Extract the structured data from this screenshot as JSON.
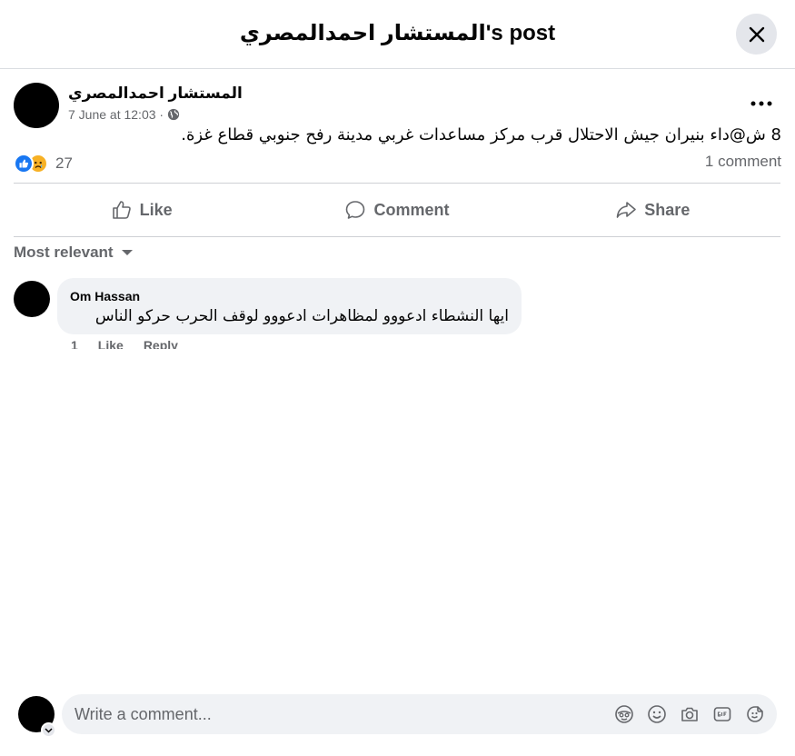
{
  "header": {
    "title": "المستشار احمدالمصري's post"
  },
  "post": {
    "author": "المستشار احمدالمصري",
    "timestamp": "7 June at 12:03 ·",
    "text": "8 ش@داء بنيران جيش الاحتلال قرب مركز مساعدات غربي مدينة رفح جنوبي قطاع غزة.",
    "reaction_count": "27",
    "comment_count": "1 comment",
    "reactions": [
      "like",
      "sad"
    ]
  },
  "actions": {
    "like": "Like",
    "comment": "Comment",
    "share": "Share"
  },
  "sort": {
    "label": "Most relevant"
  },
  "comments": [
    {
      "author": "Om Hassan",
      "text": "ايها النشطاء ادعووو لمظاهرات ادعووو لوقف الحرب حركو الناس",
      "time": "1",
      "like": "Like",
      "reply": "Reply"
    }
  ],
  "composer": {
    "placeholder": "Write a comment..."
  },
  "colors": {
    "accent": "#1877f2",
    "secondary_text": "#65676b",
    "bubble_bg": "#f0f2f5"
  }
}
